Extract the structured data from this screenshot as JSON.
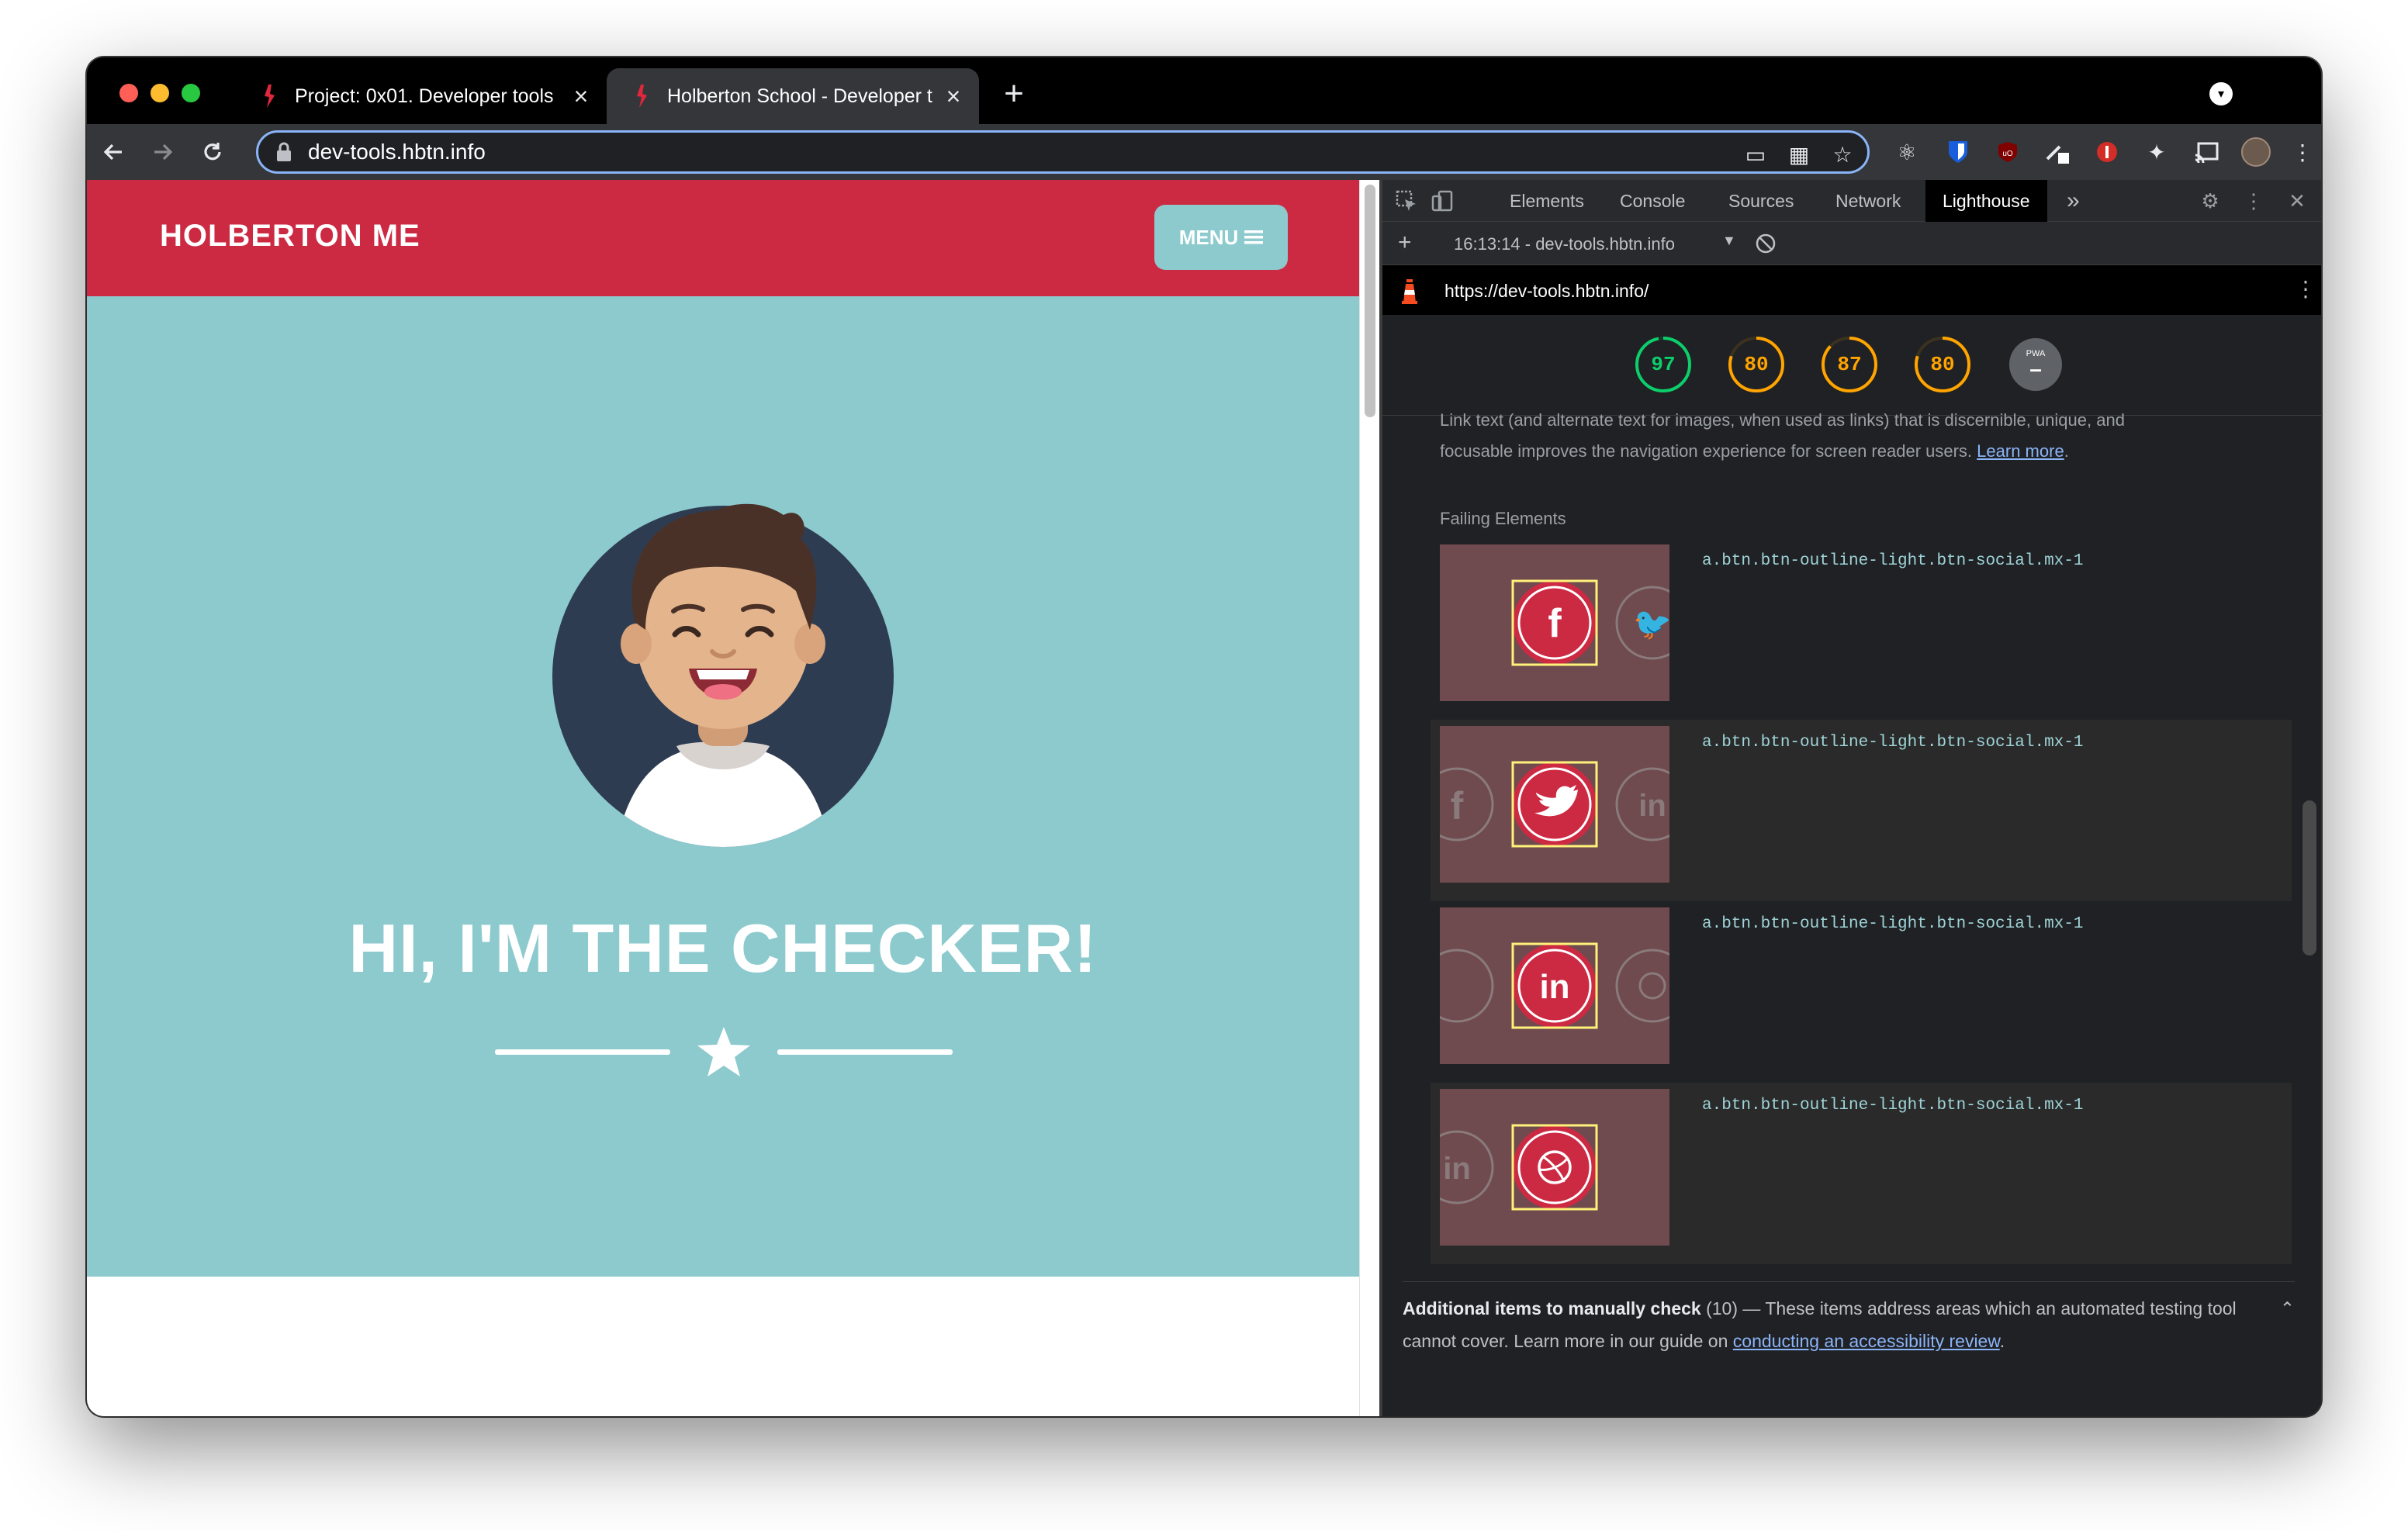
{
  "browser": {
    "tabs": [
      {
        "title": "Project: 0x01. Developer tools",
        "active": false
      },
      {
        "title": "Holberton School - Developer t",
        "active": true
      }
    ],
    "new_tab_label": "+",
    "address": "dev-tools.hbtn.info"
  },
  "page": {
    "brand": "HOLBERTON ME",
    "menu_label": "MENU",
    "hero_title": "HI, I'M THE CHECKER!",
    "colors": {
      "navbar": "#cc2a43",
      "hero": "#8ccace",
      "menu_button": "#8ccace"
    }
  },
  "devtools": {
    "tabs": [
      "Elements",
      "Console",
      "Sources",
      "Network",
      "Lighthouse"
    ],
    "active_tab": "Lighthouse",
    "more_tabs": "»",
    "report_selector": "16:13:14 - dev-tools.hbtn.info",
    "report_url": "https://dev-tools.hbtn.info/",
    "scores": [
      {
        "value": "97",
        "color": "#0cce6b",
        "fraction": 0.97
      },
      {
        "value": "80",
        "color": "#ffa400",
        "fraction": 0.8
      },
      {
        "value": "87",
        "color": "#ffa400",
        "fraction": 0.87
      },
      {
        "value": "80",
        "color": "#ffa400",
        "fraction": 0.8
      }
    ],
    "pwa_label": "PWA",
    "pwa_value": "–",
    "description_cut": "Link text (and alternate text for images, when used as links) that is discernible, unique, and",
    "description": "focusable improves the navigation experience for screen reader users.",
    "learn_more": "Learn more",
    "failing_header": "Failing Elements",
    "failing_elements": [
      {
        "selector": "a.btn.btn-outline-light.btn-social.mx-1",
        "icon": "facebook-icon"
      },
      {
        "selector": "a.btn.btn-outline-light.btn-social.mx-1",
        "icon": "twitter-icon"
      },
      {
        "selector": "a.btn.btn-outline-light.btn-social.mx-1",
        "icon": "linkedin-icon"
      },
      {
        "selector": "a.btn.btn-outline-light.btn-social.mx-1",
        "icon": "dribbble-icon"
      }
    ],
    "additional_title": "Additional items to manually check",
    "additional_count": "(10)",
    "additional_sep": "—",
    "additional_text": "These items address areas which an automated testing tool cannot cover. Learn more in our guide on",
    "additional_link": "conducting an accessibility review",
    "additional_end": "."
  }
}
